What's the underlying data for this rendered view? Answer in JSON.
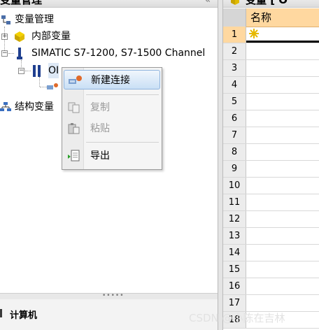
{
  "left_panel": {
    "title": "变量管理",
    "collapse_glyph": "«",
    "tree": {
      "root": "变量管理",
      "internal": "内部变量",
      "channel": "SIMATIC S7-1200, S7-1500 Channel",
      "device": "OI",
      "structured": "结构变量"
    },
    "bottom_label": "计算机"
  },
  "context_menu": {
    "items": [
      {
        "label": "新建连接",
        "icon": "new-connection-icon",
        "state": "highlighted"
      },
      {
        "label": "复制",
        "icon": "copy-icon",
        "state": "disabled"
      },
      {
        "label": "粘贴",
        "icon": "paste-icon",
        "state": "disabled"
      },
      {
        "label": "导出",
        "icon": "export-icon",
        "state": "enabled"
      }
    ]
  },
  "right_panel": {
    "title": "变量 [ O",
    "column_header": "名称",
    "rows": [
      "1",
      "2",
      "3",
      "4",
      "5",
      "6",
      "7",
      "8",
      "9",
      "10",
      "11",
      "12",
      "13",
      "14",
      "15",
      "16",
      "17",
      "18"
    ],
    "active_row": "1"
  },
  "watermark": "CSDN @小陈在吉林",
  "colors": {
    "header_orange": "#ffd8a0",
    "menu_highlight": "#c9dff5",
    "disabled_text": "#9a9a9a"
  }
}
